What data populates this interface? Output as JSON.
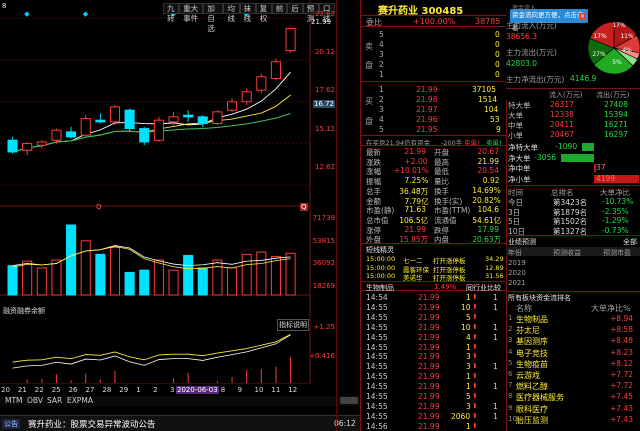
{
  "toolbar": {
    "tabs": [
      "九转",
      "重大事件",
      "加自选",
      "均线",
      "抹线",
      "复权",
      "前",
      "后",
      "预测",
      "口线"
    ],
    "ma_label": "8",
    "price_label": "21.99",
    "left_q": "Q",
    "right_q": "Q"
  },
  "price_axis": [
    "22.62",
    "20.12",
    "17.62",
    "16.72",
    "15.12",
    "12.62"
  ],
  "vol_axis": [
    "71739",
    "53815",
    "36092",
    "18269"
  ],
  "ind_axis": [
    "+1.25",
    "+0.416"
  ],
  "ind_label": "指标说明",
  "finance_label": "融资融券余额",
  "date_axis": [
    "20",
    "21",
    "22",
    "25",
    "26",
    "27",
    "28",
    "29",
    "1",
    "2",
    "3",
    "4",
    "5",
    "8",
    "9",
    "10",
    "11",
    "12"
  ],
  "date_highlight": "2020-06-03",
  "bottom_tabs": [
    "MTM",
    "OBV",
    "SAR",
    "EXPMA"
  ],
  "news_bar": {
    "icon": "公告",
    "text": "赛升药业：股票交易异常波动公告",
    "time": "06:12"
  },
  "header": {
    "title": "赛升药业 300485"
  },
  "commission": {
    "label": "委比",
    "pct": "+100.00%",
    "val": "38785"
  },
  "sell_rows": [
    {
      "label": "5",
      "price": "",
      "vol": "0"
    },
    {
      "label": "4",
      "price": "",
      "vol": "0"
    },
    {
      "label": "3",
      "price": "",
      "vol": "0"
    },
    {
      "label": "2",
      "price": "",
      "vol": "0"
    },
    {
      "label": "1",
      "price": "",
      "vol": "0"
    }
  ],
  "sell_side_chars": [
    "卖",
    "盘"
  ],
  "buy_rows": [
    {
      "label": "1",
      "price": "21.99",
      "vol": "37105"
    },
    {
      "label": "2",
      "price": "21.98",
      "vol": "1514"
    },
    {
      "label": "3",
      "price": "21.97",
      "vol": "104"
    },
    {
      "label": "4",
      "price": "21.96",
      "vol": "53"
    },
    {
      "label": "5",
      "price": "21.95",
      "vol": "9"
    }
  ],
  "buy_side_chars": [
    "买",
    "盘"
  ],
  "vol_line": {
    "label": "在买盘21.94仍有资金",
    "val": "-200手",
    "buy": "买单!",
    "sell": "卖单!"
  },
  "stats_left": [
    {
      "k": "最新",
      "v": "21.99"
    },
    {
      "k": "涨跌",
      "v": "+2.00"
    },
    {
      "k": "涨幅",
      "v": "+10.01%"
    },
    {
      "k": "振幅",
      "v": "7.25%"
    },
    {
      "k": "总手",
      "v": "36.48万"
    },
    {
      "k": "金额",
      "v": "7.79亿"
    },
    {
      "k": "市盈(静)",
      "v": "71.63"
    },
    {
      "k": "总市值",
      "v": "106.5亿"
    },
    {
      "k": "涨停",
      "v": "21.99"
    },
    {
      "k": "外盘",
      "v": "15.85万"
    }
  ],
  "stats_right": [
    {
      "k": "开盘",
      "v": "20.67"
    },
    {
      "k": "最高",
      "v": "21.99"
    },
    {
      "k": "最低",
      "v": "20.54"
    },
    {
      "k": "量比",
      "v": "0.92"
    },
    {
      "k": "换手",
      "v": "14.69%"
    },
    {
      "k": "换手(实)",
      "v": "20.82%"
    },
    {
      "k": "市盈(TTM)",
      "v": "104.6"
    },
    {
      "k": "流通值",
      "v": "54.61亿"
    },
    {
      "k": "跌停",
      "v": "17.99"
    },
    {
      "k": "内盘",
      "v": "20.63万"
    }
  ],
  "fund_flow": {
    "title": "资金流入",
    "rows": [
      {
        "k": "主力流入(万元)",
        "v": "38656.3"
      },
      {
        "k": "主力流出(万元)",
        "v": "42803.0"
      },
      {
        "k": "主力净流出(万元)",
        "v": "4146.9"
      }
    ],
    "pie_labels": [
      "17%",
      "11%",
      "4%",
      "5%",
      "27%",
      "17%"
    ],
    "popup": "资金流向更方便，点击查看"
  },
  "order_table": {
    "headers": [
      "流入(万元)",
      "流出(万元)"
    ],
    "rows": [
      {
        "k": "特大单",
        "in": "26317",
        "out": "27408"
      },
      {
        "k": "大单",
        "in": "12338",
        "out": "15394"
      },
      {
        "k": "中单",
        "in": "20411",
        "out": "16271"
      },
      {
        "k": "小单",
        "in": "20467",
        "out": "16297"
      }
    ]
  },
  "net_rows": [
    {
      "k": "净特大单",
      "v": "-1090"
    },
    {
      "k": "净大单",
      "v": "-3056"
    },
    {
      "k": "净中单",
      "v": "37"
    },
    {
      "k": "净小单",
      "v": "4199"
    }
  ],
  "rank": {
    "headers": [
      "时间",
      "总排名",
      "大单净比"
    ],
    "rows": [
      {
        "t": "今日",
        "r": "第3423名",
        "v": "-10.73%"
      },
      {
        "t": "3日",
        "r": "第1879名",
        "v": "-2.35%"
      },
      {
        "t": "5日",
        "r": "第1502名",
        "v": "-1.29%"
      },
      {
        "t": "10日",
        "r": "第1327名",
        "v": "-0.73%"
      }
    ]
  },
  "forecast": {
    "title": "业绩预测",
    "link": "全部",
    "headers": [
      "年份",
      "预测收益",
      "预测市盈"
    ],
    "years": [
      "2019",
      "2020",
      "2021"
    ]
  },
  "events": {
    "title": "短线精灵",
    "rows": [
      {
        "t": "15:00:00",
        "n": "七一二",
        "e": "打开涨停板",
        "v": "34.29"
      },
      {
        "t": "15:00:00",
        "n": "霞客环保",
        "e": "打开涨停板",
        "v": "12.89"
      },
      {
        "t": "15:00:00",
        "n": "美诺华",
        "e": "打开涨停板",
        "v": "31.56"
      }
    ]
  },
  "bio_bar": {
    "name": "生物制品",
    "pct": "1.49%",
    "link": "同行业比较"
  },
  "ticks": [
    {
      "t": "14:54",
      "p": "21.99",
      "v": "1"
    },
    {
      "t": "14:55",
      "p": "21.99",
      "v": "10"
    },
    {
      "t": "14:55",
      "p": "21.99",
      "v": "5"
    },
    {
      "t": "14:55",
      "p": "21.99",
      "v": "10"
    },
    {
      "t": "14:55",
      "p": "21.99",
      "v": "4"
    },
    {
      "t": "14:55",
      "p": "21.99",
      "v": "1"
    },
    {
      "t": "14:55",
      "p": "21.99",
      "v": "3"
    },
    {
      "t": "14:55",
      "p": "21.99",
      "v": "3"
    },
    {
      "t": "14:55",
      "p": "21.99",
      "v": "1"
    },
    {
      "t": "14:55",
      "p": "21.99",
      "v": "1"
    },
    {
      "t": "14:55",
      "p": "21.99",
      "v": "5"
    },
    {
      "t": "14:55",
      "p": "21.99",
      "v": "3"
    },
    {
      "t": "14:55",
      "p": "21.99",
      "v": "2060"
    },
    {
      "t": "14:56",
      "p": "21.99",
      "v": "1"
    }
  ],
  "tick_trades": [
    "1",
    "1",
    "",
    "1",
    "1",
    "",
    "",
    "1",
    "",
    "1",
    "",
    "1",
    "1",
    ""
  ],
  "sector": {
    "title": "所有板块资金流排名",
    "headers": [
      "名称",
      "大单净比%"
    ],
    "rows": [
      {
        "n": "生物制品",
        "v": "+8.94"
      },
      {
        "n": "芬太尼",
        "v": "+8.58"
      },
      {
        "n": "基因测序",
        "v": "+8.48"
      },
      {
        "n": "电子竞技",
        "v": "+8.23"
      },
      {
        "n": "生物疫苗",
        "v": "+8.12"
      },
      {
        "n": "云游戏",
        "v": "+7.72"
      },
      {
        "n": "燃料乙醇",
        "v": "+7.72"
      },
      {
        "n": "医疗器械服务",
        "v": "+7.45"
      },
      {
        "n": "眼科医疗",
        "v": "+7.43"
      },
      {
        "n": "胎压监测",
        "v": "+7.43"
      }
    ]
  },
  "chart_data": {
    "type": "candlestick",
    "candles": [
      {
        "o": 15.3,
        "c": 14.6,
        "h": 15.5,
        "l": 14.5
      },
      {
        "o": 14.7,
        "c": 15.1,
        "h": 15.2,
        "l": 14.4
      },
      {
        "o": 15.0,
        "c": 15.2,
        "h": 15.3,
        "l": 14.8
      },
      {
        "o": 15.3,
        "c": 15.9,
        "h": 16.0,
        "l": 15.1
      },
      {
        "o": 15.8,
        "c": 15.5,
        "h": 16.1,
        "l": 15.4
      },
      {
        "o": 15.6,
        "c": 16.6,
        "h": 16.8,
        "l": 15.5
      },
      {
        "o": 16.5,
        "c": 16.4,
        "h": 16.9,
        "l": 16.3
      },
      {
        "o": 16.4,
        "c": 17.3,
        "h": 17.4,
        "l": 16.2
      },
      {
        "o": 17.1,
        "c": 16.0,
        "h": 17.2,
        "l": 15.8
      },
      {
        "o": 16.0,
        "c": 15.2,
        "h": 16.1,
        "l": 15.0
      },
      {
        "o": 15.3,
        "c": 16.5,
        "h": 16.7,
        "l": 15.2
      },
      {
        "o": 16.4,
        "c": 16.7,
        "h": 17.0,
        "l": 16.2
      },
      {
        "o": 16.8,
        "c": 16.7,
        "h": 17.1,
        "l": 16.4
      },
      {
        "o": 16.7,
        "c": 16.3,
        "h": 16.8,
        "l": 16.1
      },
      {
        "o": 16.3,
        "c": 17.0,
        "h": 17.1,
        "l": 16.2
      },
      {
        "o": 17.1,
        "c": 17.6,
        "h": 17.8,
        "l": 17.0
      },
      {
        "o": 17.6,
        "c": 18.2,
        "h": 18.4,
        "l": 17.4
      },
      {
        "o": 18.3,
        "c": 19.1,
        "h": 19.3,
        "l": 18.1
      },
      {
        "o": 19.0,
        "c": 20.0,
        "h": 20.2,
        "l": 18.9
      },
      {
        "o": 20.67,
        "c": 21.99,
        "h": 21.99,
        "l": 20.54
      }
    ],
    "volumes": [
      26000,
      30000,
      24000,
      31000,
      62000,
      48000,
      36000,
      42000,
      20000,
      22000,
      31000,
      22000,
      35000,
      24000,
      31000,
      24000,
      36000,
      38000,
      34000,
      37000
    ],
    "ylim": [
      12.62,
      22.62
    ],
    "vol_max": 71739
  }
}
